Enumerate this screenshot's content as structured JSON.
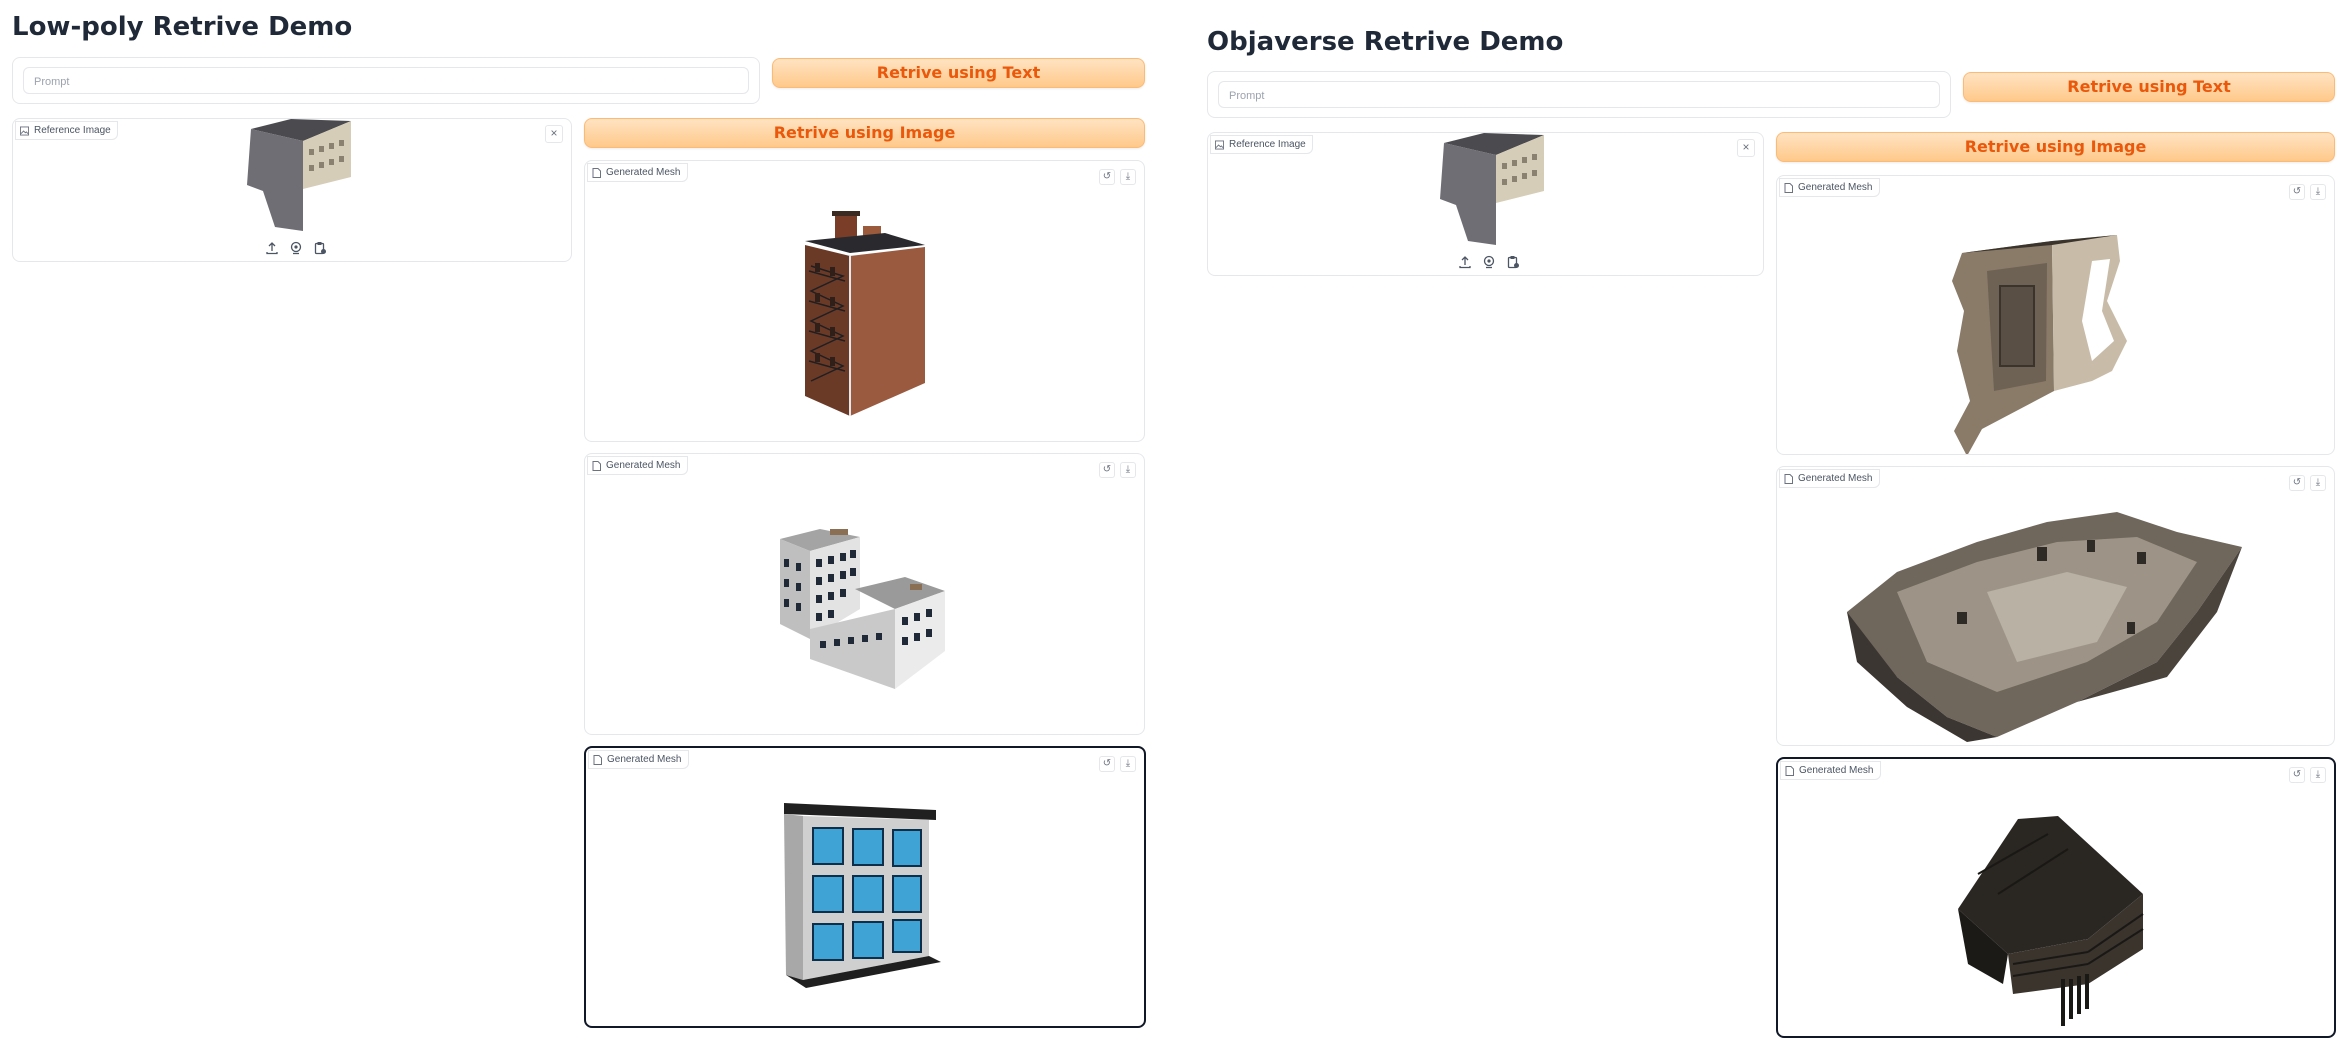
{
  "left_demo": {
    "title": "Low-poly Retrive Demo",
    "prompt_placeholder": "Prompt",
    "text_button": "Retrive using Text",
    "image_button": "Retrive using Image",
    "reference_label": "Reference Image",
    "mesh_label": "Generated Mesh"
  },
  "right_demo": {
    "title": "Objaverse Retrive Demo",
    "prompt_placeholder": "Prompt",
    "text_button": "Retrive using Text",
    "image_button": "Retrive using Image",
    "reference_label": "Reference Image",
    "mesh_label": "Generated Mesh"
  },
  "icons": {
    "close": "×",
    "reset": "↺",
    "download": "⤓"
  },
  "colors": {
    "accent": "#ea580c",
    "button_bg": "#ffd0a0"
  }
}
